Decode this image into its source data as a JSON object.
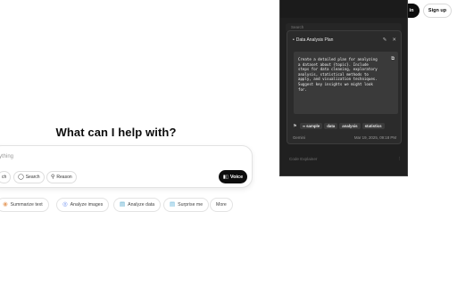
{
  "header": {
    "login_label": "in",
    "signup_label": "Sign up"
  },
  "main": {
    "heading": "What can I help with?",
    "composer": {
      "placeholder": "ything",
      "tools": [
        {
          "label": "ch",
          "icon": "globe-icon"
        },
        {
          "label": "Search",
          "icon": "globe-icon"
        },
        {
          "label": "Reason",
          "icon": "lightbulb-icon"
        }
      ],
      "voice_label": "Voice"
    },
    "suggestions": [
      {
        "label": "Summarize text",
        "icon": "document-icon",
        "color": "#e8a36b"
      },
      {
        "label": "Analyze images",
        "icon": "eye-icon",
        "color": "#6b8ff0"
      },
      {
        "label": "Analyze data",
        "icon": "chart-icon",
        "color": "#4aa3c9"
      },
      {
        "label": "Surprise me",
        "icon": "gift-icon",
        "color": "#5ab0d8"
      },
      {
        "label": "More",
        "icon": "",
        "color": "#555555"
      }
    ]
  },
  "overlay": {
    "search_text": "Search",
    "card": {
      "title": "Data Analysis Plan",
      "prompt": "Create a detailed plan for analyzing\na dataset about {topic}. Include\nsteps for data cleaning, exploratory\nanalysis, statistical methods to\napply, and visualization techniques.\nSuggest key insights we might look\nfor.",
      "tags": [
        "sample",
        "data",
        "analysis",
        "statistics"
      ],
      "author": "Gemini",
      "date": "Mar 19, 2025, 09:18 PM"
    },
    "bottom_item": "Code Explainer"
  },
  "colors": {
    "overlay_bg": "#202020",
    "card_bg": "#2b2b2b",
    "prompt_bg": "#3a3a3a",
    "primary_button": "#0d0d0d"
  }
}
